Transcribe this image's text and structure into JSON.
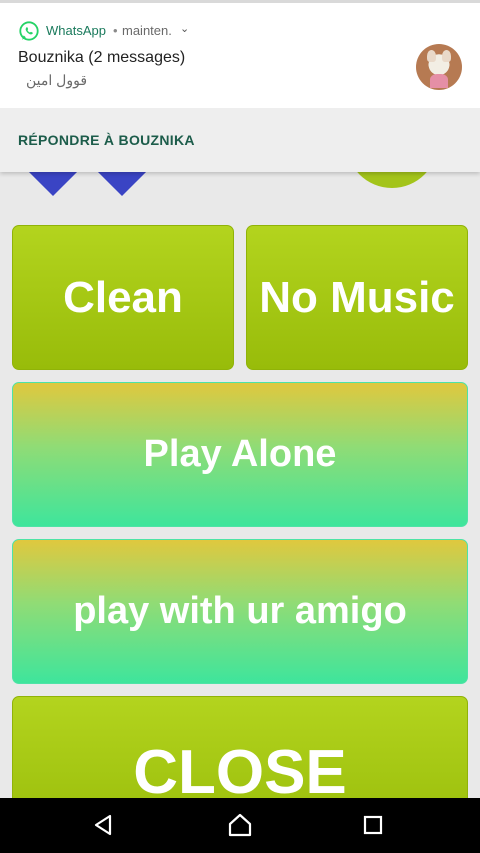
{
  "notification": {
    "app_name": "WhatsApp",
    "separator": "•",
    "time": "mainten.",
    "title": "Bouznika (2 messages)",
    "message": "قوول امين",
    "reply_action": "RÉPONDRE À BOUZNIKA"
  },
  "game": {
    "buttons": {
      "clean": "Clean",
      "no_music": "No Music",
      "play_alone": "Play Alone",
      "play_with_amigo": "play with ur amigo",
      "close": "CLOSE"
    }
  },
  "colors": {
    "whatsapp_green": "#25D366",
    "button_green": "#a3c41a",
    "diamond_blue": "#3a44c4",
    "gradient_top": "#e0c83e",
    "gradient_bottom": "#3ee59c"
  },
  "navbar": {
    "icons": [
      "back-icon",
      "home-icon",
      "recent-apps-icon"
    ]
  }
}
